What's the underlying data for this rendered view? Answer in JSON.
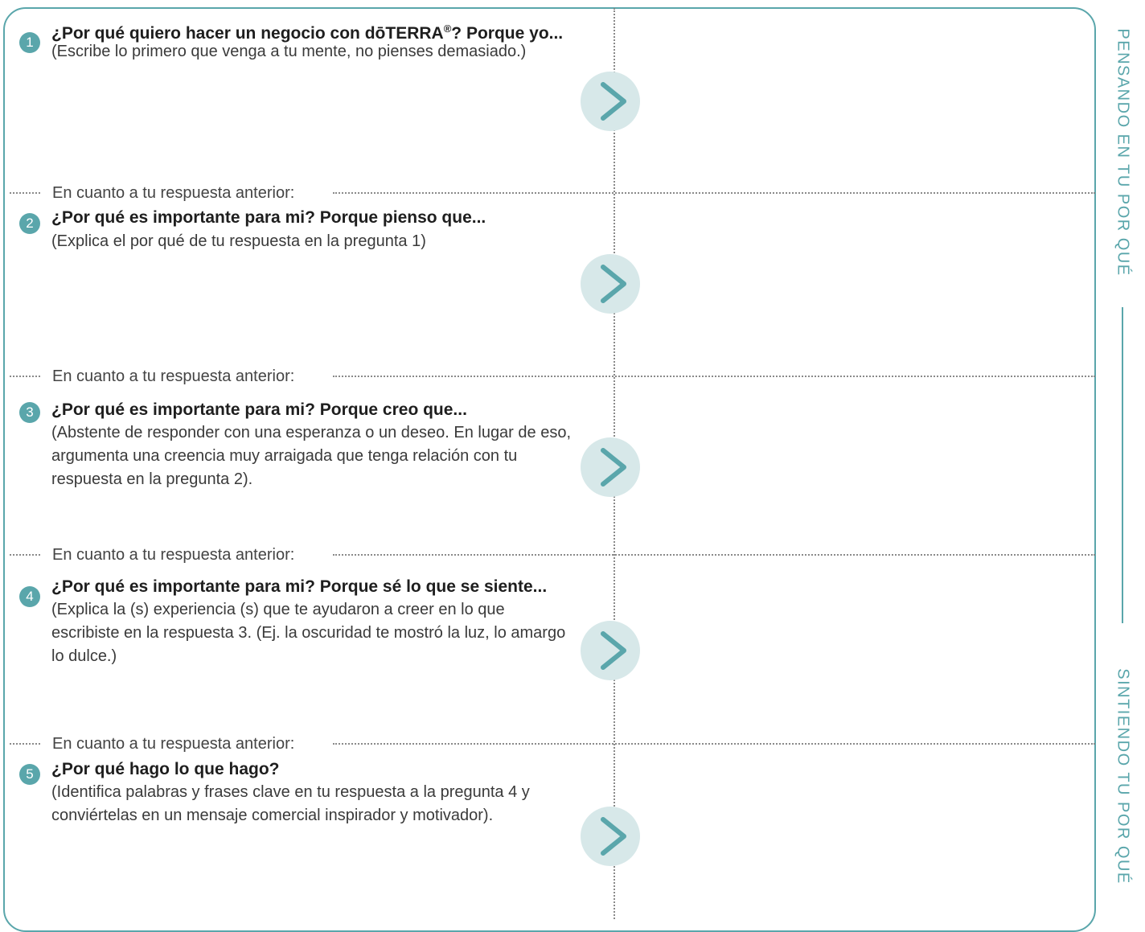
{
  "section_label": "En cuanto a tu respuesta anterior:",
  "questions": [
    {
      "number": "1",
      "title": "¿Por qué quiero hacer un negocio con dōTERRA",
      "title_mark": "®",
      "title_end": "?  Porque yo...",
      "hint": "(Escribe lo primero que venga a tu mente, no pienses demasiado.)"
    },
    {
      "number": "2",
      "title": "¿Por qué es importante para mi?  Porque pienso que...",
      "hint": "(Explica el por qué de tu respuesta en la pregunta 1)"
    },
    {
      "number": "3",
      "title": "¿Por qué es importante para mi?  Porque creo que...",
      "hint": "(Abstente de responder con una esperanza o un deseo. En lugar de eso, argumenta una creencia muy arraigada que tenga relación con tu respuesta en la pregunta 2)."
    },
    {
      "number": "4",
      "title": "¿Por qué es importante para mi?  Porque sé lo que se siente...",
      "hint": "(Explica la (s) experiencia (s) que te ayudaron a creer en lo que escribiste en la respuesta 3. (Ej. la oscuridad te mostró la luz, lo amargo lo dulce.)"
    },
    {
      "number": "5",
      "title": "¿Por qué hago lo que hago?",
      "hint": "(Identifica palabras y frases clave en tu respuesta a la pregunta 4 y conviértelas en un mensaje comercial inspirador y motivador)."
    }
  ],
  "side": {
    "top": "PENSANDO EN TU POR QUÉ",
    "bottom": "SINTIENDO TU POR QUÉ"
  },
  "colors": {
    "accent": "#5aa6ab",
    "chevron_bg": "#d7e8e9"
  },
  "icons": {
    "arrow": "chevron-right-icon"
  }
}
